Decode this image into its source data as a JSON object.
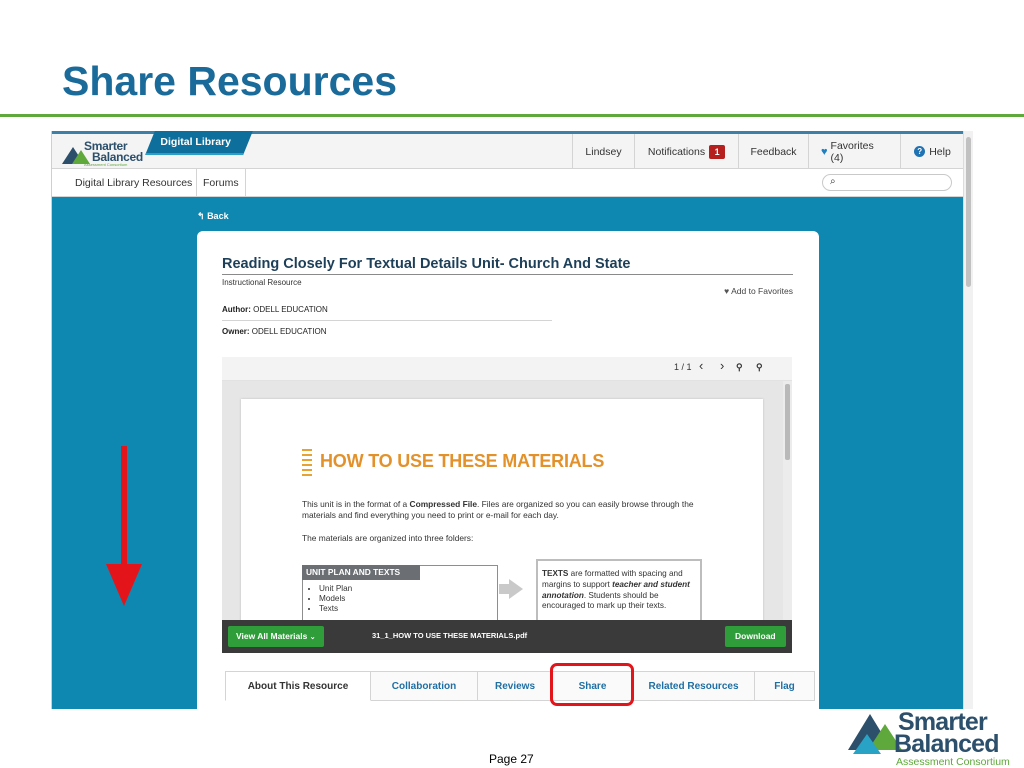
{
  "slide": {
    "title": "Share Resources",
    "page_label": "Page 27"
  },
  "app": {
    "logo": {
      "line1": "Smarter",
      "line2": "Balanced",
      "line3": "Assessment Consortium"
    },
    "brand_tab": "Digital Library",
    "nav": {
      "user": "Lindsey",
      "notifications": "Notifications",
      "notifications_count": "1",
      "feedback": "Feedback",
      "favorites": "Favorites (4)",
      "help": "Help"
    },
    "subnav": {
      "resources": "Digital Library Resources",
      "forums": "Forums",
      "search_icon": "🔍"
    },
    "back_label": "Back"
  },
  "resource": {
    "title": "Reading Closely For Textual Details Unit- Church And State",
    "type": "Instructional Resource",
    "add_favorites": "Add to Favorites",
    "author_label": "Author:",
    "author": "ODELL EDUCATION",
    "owner_label": "Owner:",
    "owner": "ODELL EDUCATION"
  },
  "viewer": {
    "page_count": "1 / 1",
    "prev": "‹",
    "next": "›",
    "zoom_out": "zoom-out-icon",
    "zoom_in": "zoom-in-icon",
    "document": {
      "heading": "HOW TO USE THESE MATERIALS",
      "para1_a": "This unit is in the format of a ",
      "para1_b": "Compressed File",
      "para1_c": ". Files are organized so you can easily browse through the materials and find everything you need to print or e-mail for each day.",
      "para2": "The materials are organized into three folders:",
      "box1_title": "UNIT PLAN AND TEXTS",
      "box1_items": [
        "Unit Plan",
        "Models",
        "Texts"
      ],
      "box2_a": "TEXTS",
      "box2_b": " are formatted with spacing and margins to support ",
      "box2_c": "teacher and student annotation",
      "box2_d": ". Students should be encouraged to mark up their texts."
    },
    "footer": {
      "view_all": "View All Materials",
      "file_name": "31_1_HOW TO USE THESE MATERIALS.pdf",
      "download": "Download"
    }
  },
  "tabs": [
    {
      "label": "About This Resource"
    },
    {
      "label": "Collaboration"
    },
    {
      "label": "Reviews"
    },
    {
      "label": "Share"
    },
    {
      "label": "Related Resources"
    },
    {
      "label": "Flag"
    }
  ],
  "footer_logo": {
    "line1": "Smarter",
    "line2": "Balanced",
    "line3": "Assessment Consortium"
  },
  "colors": {
    "title_blue": "#1a6a9a",
    "accent_green": "#5fa83c",
    "app_background": "#0e88b0",
    "highlight_red": "#e3151b"
  }
}
